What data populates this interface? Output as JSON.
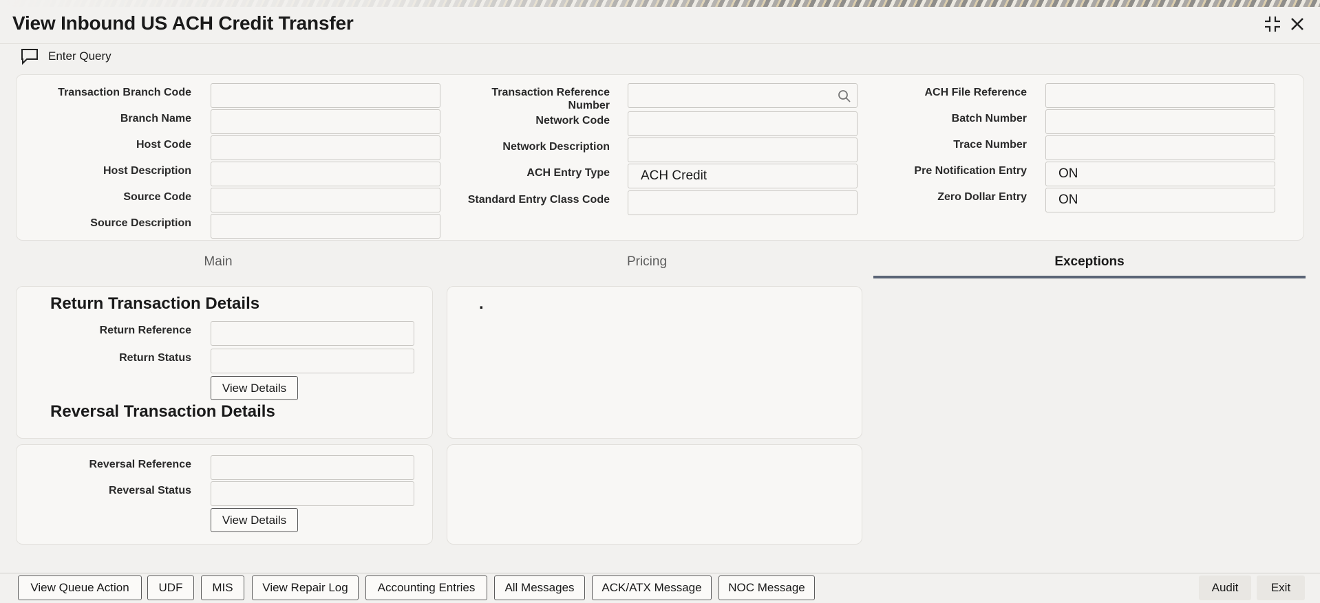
{
  "window": {
    "title": "View Inbound US ACH Credit Transfer",
    "controls": {
      "maximize_icon": "maximize-icon",
      "close_icon": "close-icon"
    }
  },
  "toolbar": {
    "enter_query_label": "Enter Query",
    "icon": "chat-bubble-icon"
  },
  "header_form": {
    "col1": [
      {
        "label": "Transaction Branch Code",
        "value": ""
      },
      {
        "label": "Branch Name",
        "value": ""
      },
      {
        "label": "Host Code",
        "value": ""
      },
      {
        "label": "Host Description",
        "value": ""
      },
      {
        "label": "Source Code",
        "value": ""
      },
      {
        "label": "Source Description",
        "value": ""
      }
    ],
    "col2": [
      {
        "label_line1": "Transaction Reference",
        "label_line2": "Number",
        "value": "",
        "icon": "search-icon"
      },
      {
        "label": "Network Code",
        "value": ""
      },
      {
        "label": "Network Description",
        "value": ""
      },
      {
        "label": "ACH Entry Type",
        "value": "ACH Credit"
      },
      {
        "label": "Standard Entry Class Code",
        "value": ""
      }
    ],
    "col3": [
      {
        "label": "ACH File Reference",
        "value": ""
      },
      {
        "label": "Batch Number",
        "value": ""
      },
      {
        "label": "Trace Number",
        "value": ""
      },
      {
        "label": "Pre Notification Entry",
        "value": "ON"
      },
      {
        "label": "Zero Dollar Entry",
        "value": "ON"
      }
    ]
  },
  "tabs": [
    {
      "label": "Main",
      "active": false
    },
    {
      "label": "Pricing",
      "active": false
    },
    {
      "label": "Exceptions",
      "active": true
    }
  ],
  "return_section": {
    "title": "Return Transaction Details",
    "reference_label": "Return Reference",
    "reference_value": "",
    "status_label": "Return Status",
    "status_value": "",
    "view_details_label": "View Details"
  },
  "reversal_section": {
    "title": "Reversal Transaction Details",
    "reference_label": "Reversal Reference",
    "reference_value": "",
    "status_label": "Reversal Status",
    "status_value": "",
    "view_details_label": "View Details"
  },
  "pricing_panel": {
    "dot": "."
  },
  "footer": {
    "buttons": [
      "View Queue Action",
      "UDF",
      "MIS",
      "View Repair Log",
      "Accounting Entries",
      "All Messages",
      "ACK/ATX Message",
      "NOC Message"
    ],
    "audit_label": "Audit",
    "exit_label": "Exit"
  }
}
